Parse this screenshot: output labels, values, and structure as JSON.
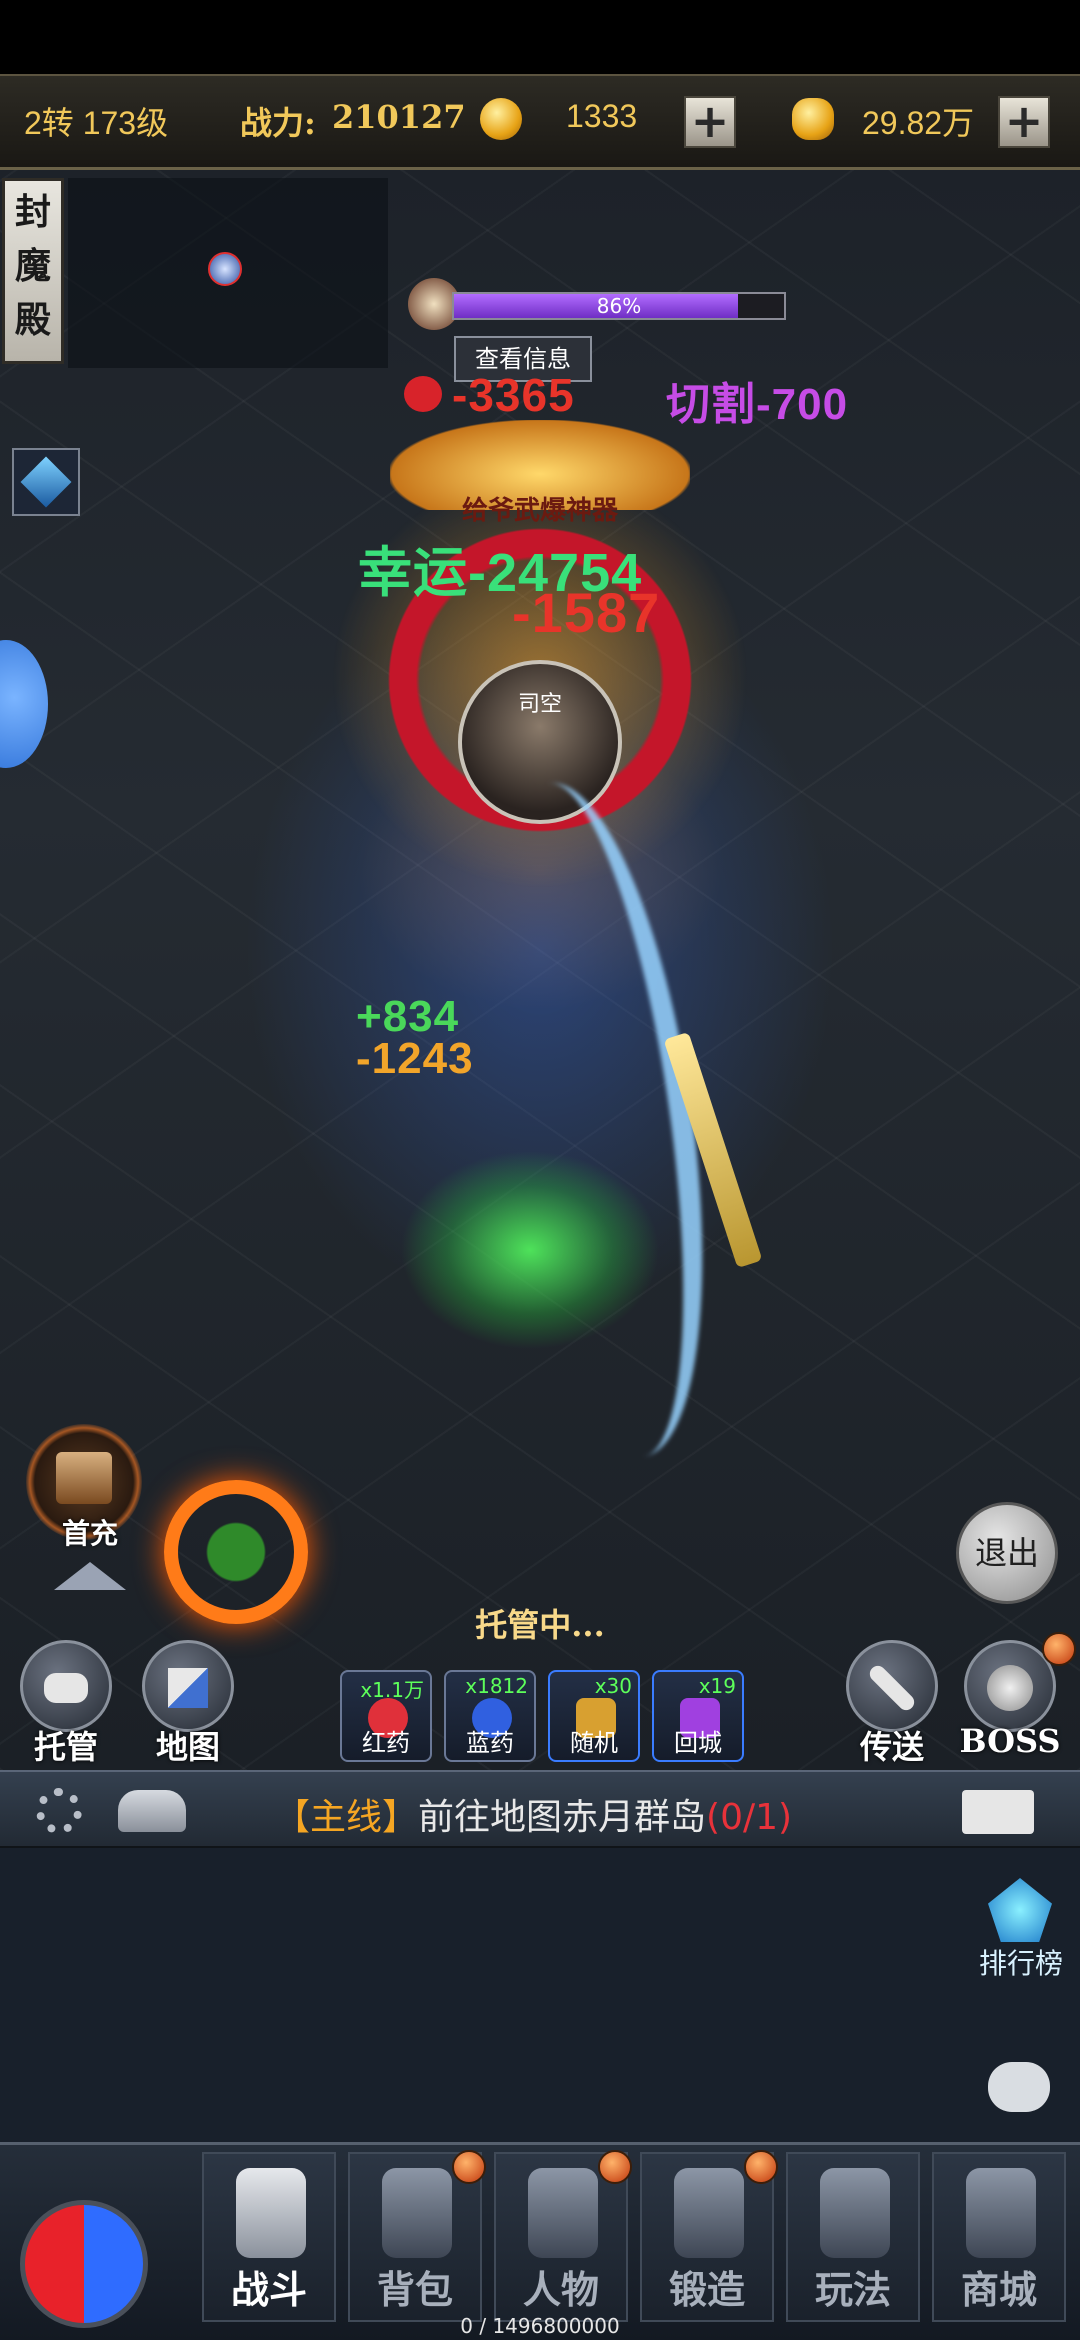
{
  "top_bar": {
    "level": "2转 173级",
    "power_label": "战力:",
    "power_value": "210127",
    "currency1_amount": "1333",
    "currency2_amount": "29.82万"
  },
  "left": {
    "zone_name": "封\n魔\n殿"
  },
  "boss": {
    "hp_percent": 86,
    "hp_label": "86%",
    "view_info": "查看信息",
    "title_badge": "给爷武爆神器",
    "player_name": "司空"
  },
  "combat_text": {
    "dmg_main": "-3365",
    "cut_dmg": "切割-700",
    "lucky": "幸运-24754",
    "bleed": "-1587",
    "heal": "+834",
    "dmg_small": "-1243"
  },
  "hud": {
    "first_charge": "首充",
    "auto_status": "托管中...",
    "exit": "退出"
  },
  "actions": {
    "auto": "托管",
    "map": "地图",
    "teleport": "传送",
    "boss": "BOSS"
  },
  "items": [
    {
      "name": "红药",
      "count": "x1.1万",
      "color": "#e0303a"
    },
    {
      "name": "蓝药",
      "count": "x1812",
      "color": "#3060e0"
    },
    {
      "name": "随机",
      "count": "x30",
      "color": "#d8a030"
    },
    {
      "name": "回城",
      "count": "x19",
      "color": "#a040e0"
    }
  ],
  "quest": {
    "tag": "【主线】",
    "text": "前往地图赤月群岛",
    "progress": "(0/1)"
  },
  "side": {
    "rank": "排行榜"
  },
  "nav": {
    "tabs": [
      "战斗",
      "背包",
      "人物",
      "锻造",
      "玩法",
      "商城"
    ]
  },
  "exp": "0 / 1496800000",
  "colors": {
    "gold": "#f1c85a",
    "quest_tag": "#f5a623",
    "quest_progress": "#e8323a",
    "lucky_green": "#39e07a",
    "damage_red": "#e8342a",
    "cut_purple": "#c64ce6",
    "hp_purple": "#8a3ee0"
  }
}
